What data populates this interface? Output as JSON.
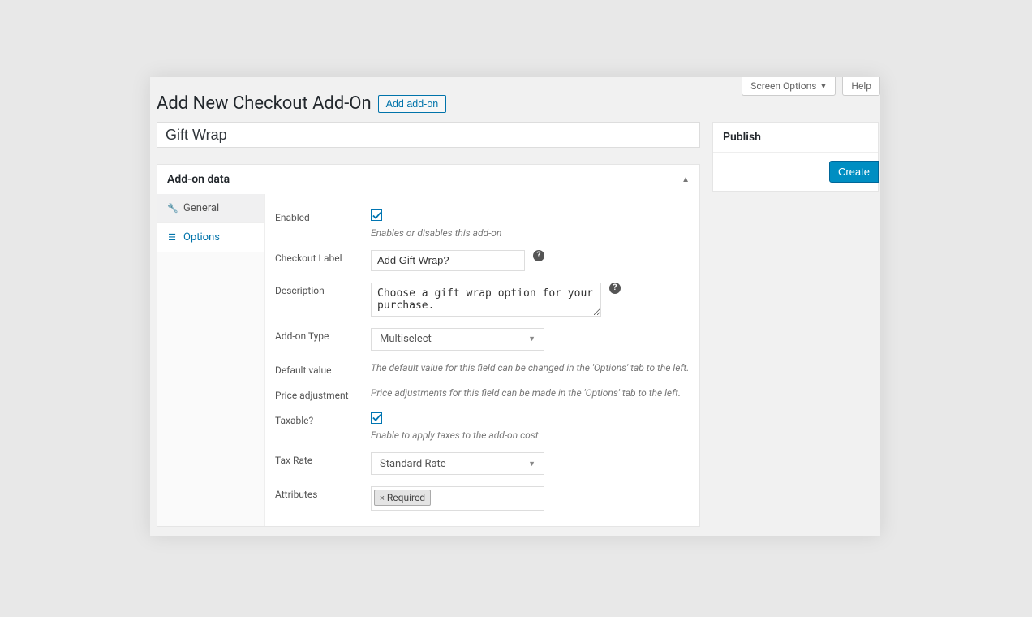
{
  "topbar": {
    "screen_options": "Screen Options",
    "help": "Help"
  },
  "heading": {
    "title": "Add New Checkout Add-On",
    "add_button": "Add add-on"
  },
  "post": {
    "title_value": "Gift Wrap"
  },
  "metabox": {
    "title": "Add-on data"
  },
  "tabs": {
    "general": "General",
    "options": "Options"
  },
  "fields": {
    "enabled": {
      "label": "Enabled",
      "hint": "Enables or disables this add-on",
      "checked": true
    },
    "checkout_label": {
      "label": "Checkout Label",
      "value": "Add Gift Wrap?"
    },
    "description": {
      "label": "Description",
      "value": "Choose a gift wrap option for your purchase."
    },
    "addon_type": {
      "label": "Add-on Type",
      "value": "Multiselect"
    },
    "default_value": {
      "label": "Default value",
      "text": "The default value for this field can be changed in the 'Options' tab to the left."
    },
    "price_adjustment": {
      "label": "Price adjustment",
      "text": "Price adjustments for this field can be made in the 'Options' tab to the left."
    },
    "taxable": {
      "label": "Taxable?",
      "hint": "Enable to apply taxes to the add-on cost",
      "checked": true
    },
    "tax_rate": {
      "label": "Tax Rate",
      "value": "Standard Rate"
    },
    "attributes": {
      "label": "Attributes",
      "tag": "Required"
    }
  },
  "publish": {
    "title": "Publish",
    "create": "Create"
  }
}
